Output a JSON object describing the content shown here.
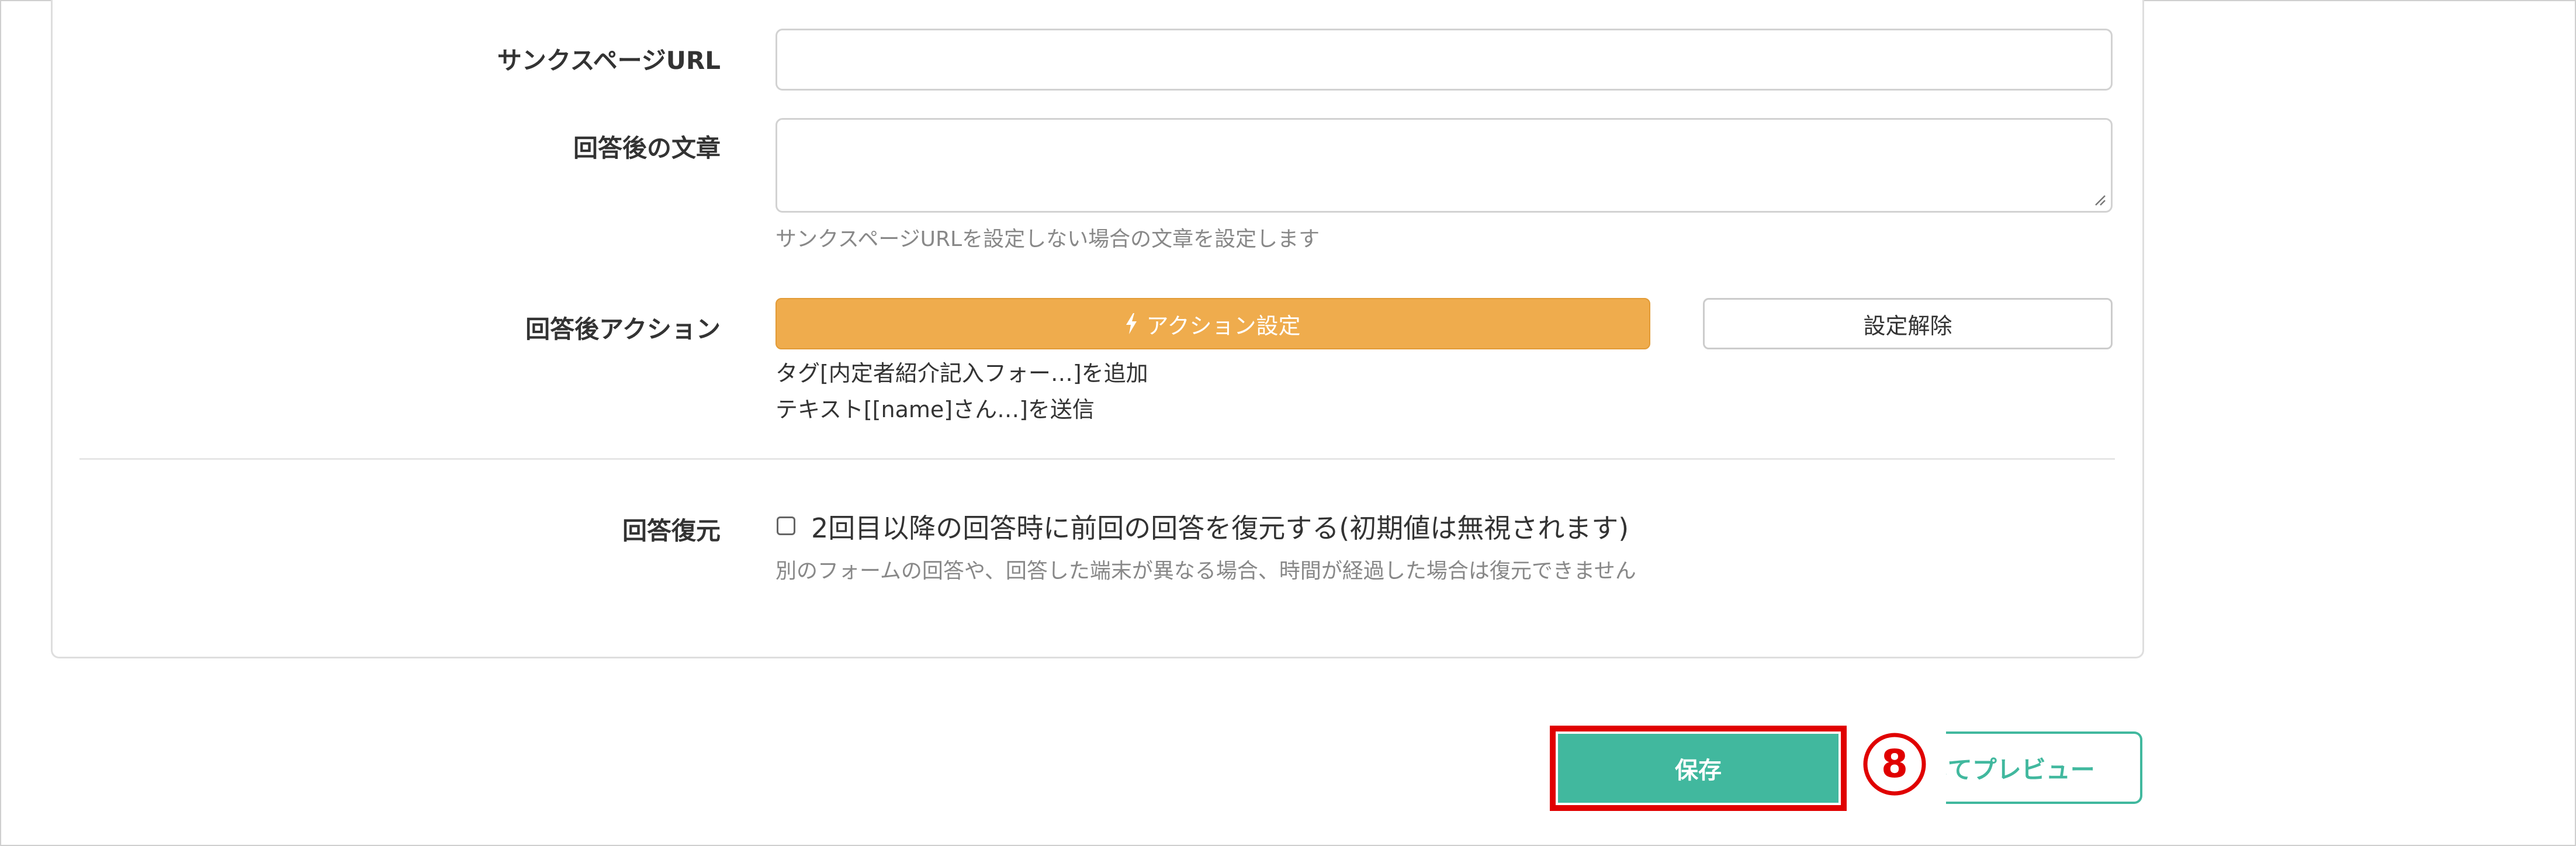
{
  "form": {
    "thanks_url": {
      "label": "サンクスページURL",
      "value": ""
    },
    "after_text": {
      "label": "回答後の文章",
      "value": "",
      "help": "サンクスページURLを設定しない場合の文章を設定します"
    },
    "after_action": {
      "label": "回答後アクション",
      "action_button": "アクション設定",
      "clear_button": "設定解除",
      "actions": [
        "タグ[内定者紹介記入フォー…]を追加",
        "テキスト[[name]さん…]を送信"
      ]
    },
    "restore": {
      "label": "回答復元",
      "checkbox_label": "2回目以降の回答時に前回の回答を復元する(初期値は無視されます)",
      "checked": false,
      "help": "別のフォームの回答や、回答した端末が異なる場合、時間が経過した場合は復元できません"
    }
  },
  "footer": {
    "save_button": "保存",
    "preview_button": "してプレビュー",
    "step_marker": "⑧"
  },
  "colors": {
    "accent_orange": "#efac4d",
    "primary_green": "#41b89e",
    "highlight_red": "#e00000"
  },
  "icons": {
    "action": "bolt-icon"
  }
}
